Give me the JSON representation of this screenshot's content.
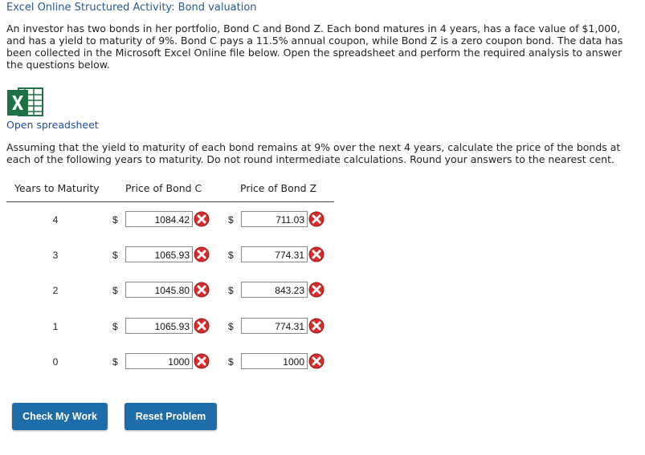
{
  "title": "Excel Online Structured Activity: Bond valuation",
  "intro": "An investor has two bonds in her portfolio, Bond C and Bond Z. Each bond matures in 4 years, has a face value of $1,000, and has a yield to maturity of 9%. Bond C pays a 11.5% annual coupon, while Bond Z is a zero coupon bond. The data has been collected in the Microsoft Excel Online file below. Open the spreadsheet and perform the required analysis to answer the questions below.",
  "open_spreadsheet_label": "Open spreadsheet",
  "instructions": "Assuming that the yield to maturity of each bond remains at 9% over the next 4 years, calculate the price of the bonds at each of the following years to maturity. Do not round intermediate calculations. Round your answers to the nearest cent.",
  "table": {
    "headers": {
      "years": "Years to Maturity",
      "bond_c": "Price of Bond C",
      "bond_z": "Price of Bond Z"
    },
    "currency_symbol": "$",
    "rows": [
      {
        "years": "4",
        "bond_c": "1084.42",
        "bond_z": "711.03"
      },
      {
        "years": "3",
        "bond_c": "1065.93",
        "bond_z": "774.31"
      },
      {
        "years": "2",
        "bond_c": "1045.80",
        "bond_z": "843.23"
      },
      {
        "years": "1",
        "bond_c": "1065.93",
        "bond_z": "774.31"
      },
      {
        "years": "0",
        "bond_c": "1000",
        "bond_z": "1000"
      }
    ]
  },
  "buttons": {
    "check": "Check My Work",
    "reset": "Reset Problem"
  },
  "icons": {
    "excel": "excel-icon",
    "incorrect": "incorrect-x-icon"
  },
  "colors": {
    "title": "#2b5a8c",
    "link": "#1f4e9c",
    "button": "#1e6ca8",
    "excel_green": "#1e7145",
    "incorrect_red": "#d62b2b"
  }
}
